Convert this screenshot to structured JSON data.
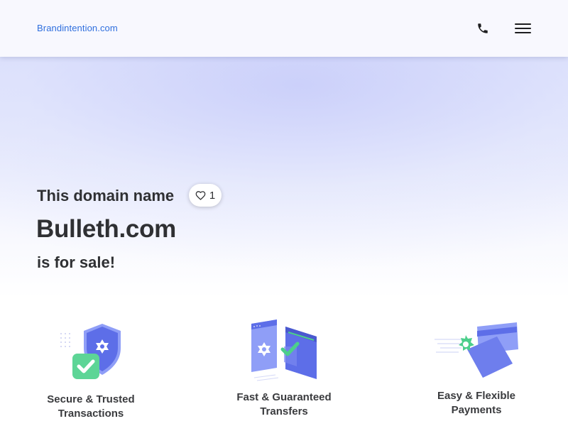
{
  "header": {
    "brand": "Brandintention.com",
    "phone_icon": "phone-icon",
    "menu_icon": "hamburger-menu-icon"
  },
  "hero": {
    "line1": "This domain name",
    "domain": "Bulleth.com",
    "line3": "is for sale!",
    "likes": {
      "icon": "heart-icon",
      "count": "1"
    }
  },
  "features": [
    {
      "icon": "shield-check-icon",
      "line1": "Secure & Trusted",
      "line2": "Transactions"
    },
    {
      "icon": "transfer-windows-icon",
      "line1": "Fast & Guaranteed",
      "line2": "Transfers"
    },
    {
      "icon": "credit-cards-icon",
      "line1": "Easy & Flexible",
      "line2": "Payments"
    }
  ],
  "colors": {
    "brand_link": "#2f6fde",
    "text": "#2f3033",
    "accent_blue": "#5d6ee8",
    "accent_green": "#4ccf8b"
  }
}
